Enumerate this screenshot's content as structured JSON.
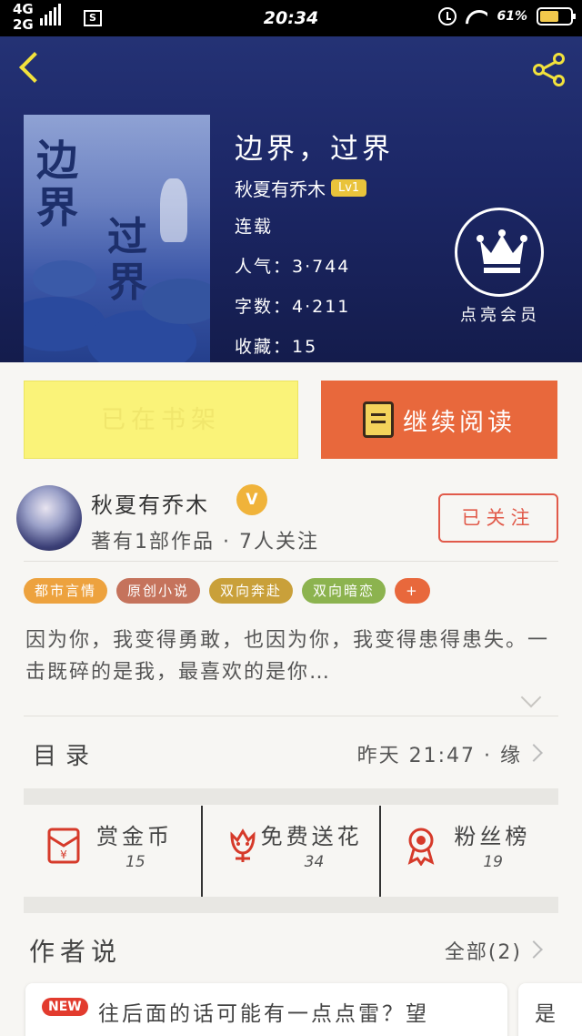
{
  "status_bar": {
    "network_top": "4G",
    "network_bottom": "2G",
    "sim_label": "S",
    "time": "20:34",
    "battery": "61%",
    "battery_level": 0.61
  },
  "book": {
    "title": "边界，过界",
    "cover_title_1": "边界",
    "cover_title_2": "过界",
    "author": "秋夏有乔木",
    "level": "Lv1",
    "status": "连载",
    "popularity": "人气：3·744",
    "word_count": "字数：4·211",
    "favorites": "收藏：15"
  },
  "vip": {
    "label": "点亮会员"
  },
  "actions": {
    "shelf_label": "已在书架",
    "read_label": "继续阅读"
  },
  "author_card": {
    "name": "秋夏有乔木",
    "verified": "V",
    "stats": "著有1部作品 · 7人关注",
    "follow_label": "已关注"
  },
  "tags": [
    {
      "label": "都市言情",
      "color": "#eda23e"
    },
    {
      "label": "原创小说",
      "color": "#c5735c"
    },
    {
      "label": "双向奔赴",
      "color": "#c9a03a"
    },
    {
      "label": "双向暗恋",
      "color": "#8cb34f"
    },
    {
      "label": "+",
      "color": "#e8683c"
    }
  ],
  "synopsis": "因为你，我变得勇敢，也因为你，我变得患得患失。一击既碎的是我，最喜欢的是你…",
  "directory": {
    "label": "目录",
    "meta": "昨天 21:47 · 缘"
  },
  "stats": [
    {
      "label": "赏金币",
      "count": "15",
      "icon": "red-envelope-icon"
    },
    {
      "label": "免费送花",
      "count": "34",
      "icon": "flower-icon"
    },
    {
      "label": "粉丝榜",
      "count": "19",
      "icon": "ribbon-medal-icon"
    }
  ],
  "author_says": {
    "title": "作者说",
    "all_label": "全部(2)",
    "new_badge": "NEW",
    "card1_text": "往后面的话可能有一点点雷？望",
    "card2_text": "是"
  }
}
